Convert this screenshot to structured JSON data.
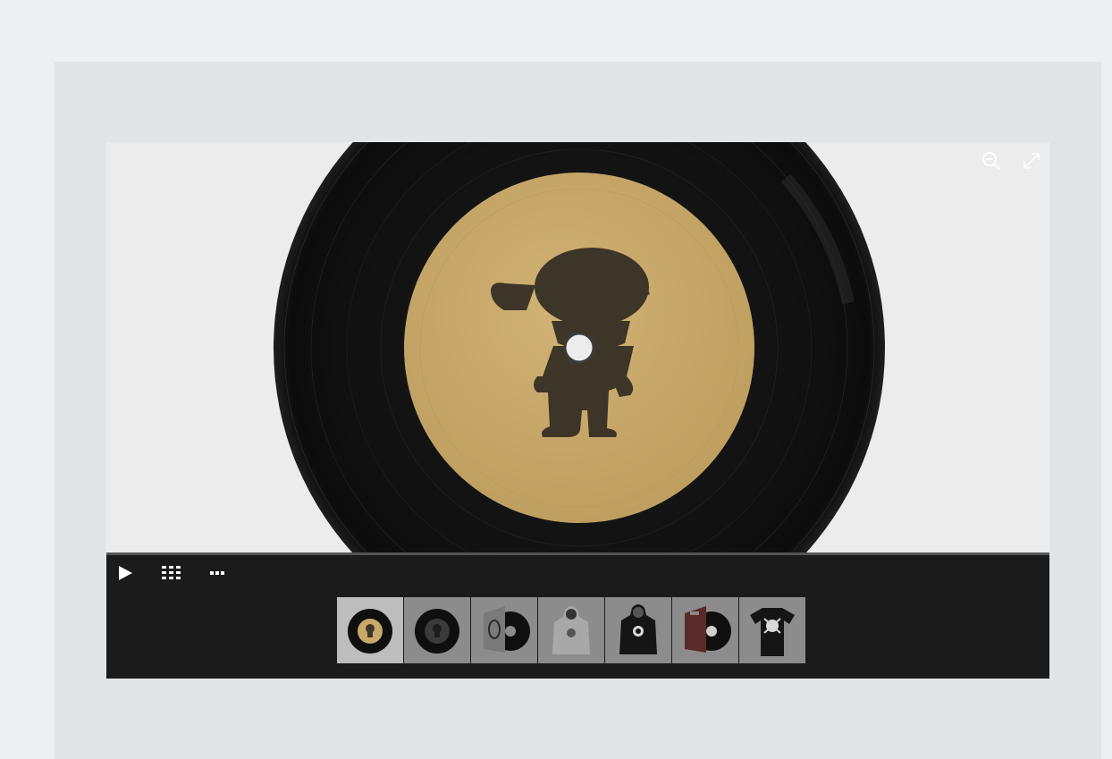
{
  "colors": {
    "page_bg": "#edf0f2",
    "panel_bg": "#e2e5e7",
    "stage_bg": "#ececec",
    "gallery_bar_bg": "#1b1b1b",
    "vinyl_black": "#111111",
    "label_gold": "#c8a96a",
    "silhouette_brown": "#3d3527",
    "icon_white": "#ffffff"
  },
  "viewer": {
    "zoom_tool_icon": "zoom-out-icon",
    "fullscreen_tool_icon": "fullscreen-expand-icon"
  },
  "controls": [
    {
      "name": "play",
      "icon": "play-icon"
    },
    {
      "name": "thumbnails",
      "icon": "grid-icon"
    },
    {
      "name": "more",
      "icon": "ellipsis-icon"
    }
  ],
  "thumbnails": [
    {
      "subject": "gold-label-vinyl-record",
      "active": true
    },
    {
      "subject": "dark-label-vinyl-record",
      "active": false
    },
    {
      "subject": "record-sleeve-with-vinyl",
      "active": false
    },
    {
      "subject": "grey-hoodie",
      "active": false
    },
    {
      "subject": "black-hoodie",
      "active": false
    },
    {
      "subject": "red-record-sleeve-with-vinyl",
      "active": false
    },
    {
      "subject": "black-t-shirt",
      "active": false
    }
  ]
}
